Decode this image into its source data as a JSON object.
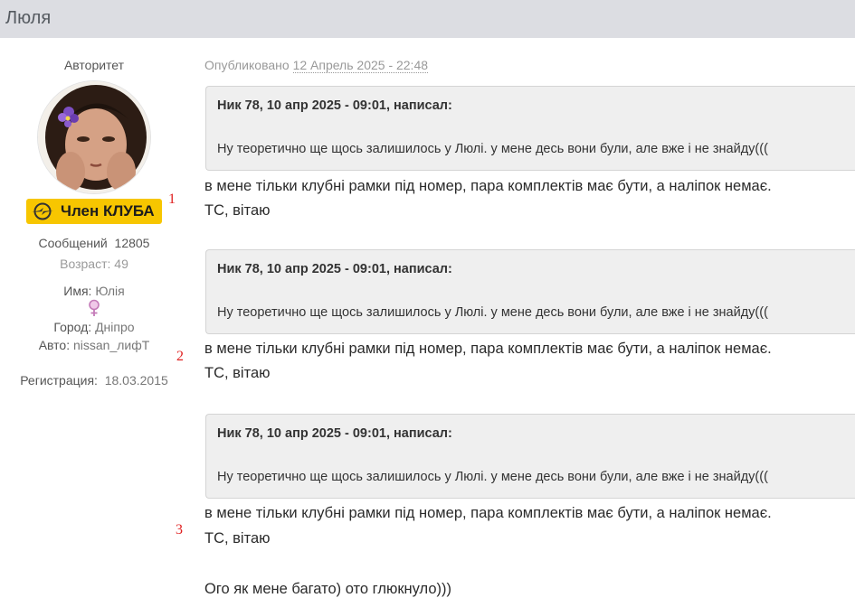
{
  "topic": {
    "title": "Люля"
  },
  "user": {
    "rank": "Авторитет",
    "badge": "Член КЛУБА",
    "posts_label": "Сообщений",
    "posts": "12805",
    "age_label": "Возраст:",
    "age": "49",
    "name_label": "Имя:",
    "name": "Юлія",
    "city_label": "Город:",
    "city": "Дніпро",
    "car_label": "Авто:",
    "car": "nissan_лифТ",
    "reg_label": "Регистрация:",
    "reg_date": "18.03.2015"
  },
  "markers": [
    "1",
    "2",
    "3"
  ],
  "post": {
    "published_label": "Опубликовано",
    "published_date": "12 Апрель 2025 - 22:48",
    "quotes": [
      {
        "head": "Ник 78, 10 апр 2025 - 09:01, написал:",
        "body": "Ну теоретично ще щось залишилось у Люлі. у мене десь вони були, але вже і не знайду((("
      },
      {
        "head": "Ник 78, 10 апр 2025 - 09:01, написал:",
        "body": "Ну теоретично ще щось залишилось у Люлі. у мене десь вони були, але вже і не знайду((("
      },
      {
        "head": "Ник 78, 10 апр 2025 - 09:01, написал:",
        "body": "Ну теоретично ще щось залишилось у Люлі. у мене десь вони були, але вже і не знайду((("
      }
    ],
    "replies": [
      {
        "line1": "в мене тільки клубні рамки під номер, пара комплектів має бути, а наліпок немає.",
        "line2": "ТС, вітаю"
      },
      {
        "line1": "в мене тільки клубні рамки під номер, пара комплектів має бути, а наліпок немає.",
        "line2": "ТС, вітаю"
      },
      {
        "line1": "в мене тільки клубні рамки під номер, пара комплектів має бути, а наліпок немає.",
        "line2": "ТС, вітаю"
      }
    ],
    "final_line": "Ого як мене багато) ото глюкнуло)))"
  },
  "colors": {
    "badge": "#f7c600",
    "marker": "#e02020",
    "quote_bg": "#efefef",
    "header_bg": "#dcdde2"
  }
}
